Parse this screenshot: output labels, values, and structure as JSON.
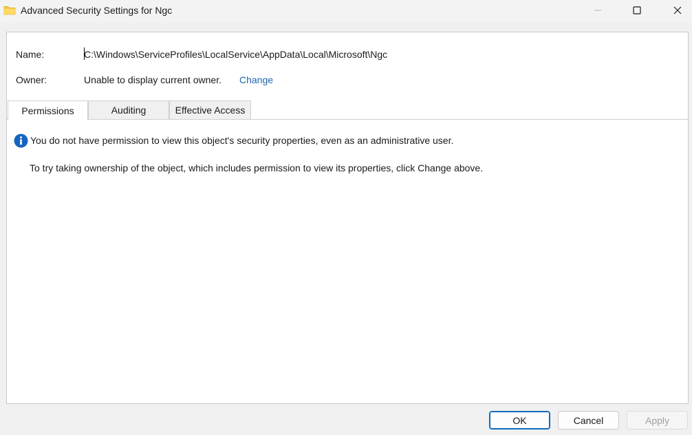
{
  "window": {
    "title": "Advanced Security Settings for Ngc"
  },
  "fields": {
    "name_label": "Name:",
    "name_value": "C:\\Windows\\ServiceProfiles\\LocalService\\AppData\\Local\\Microsoft\\Ngc",
    "owner_label": "Owner:",
    "owner_value": "Unable to display current owner.",
    "change_link": "Change"
  },
  "tabs": [
    {
      "label": "Permissions",
      "selected": true
    },
    {
      "label": "Auditing",
      "selected": false
    },
    {
      "label": "Effective Access",
      "selected": false
    }
  ],
  "messages": {
    "no_permission": "You do not have permission to view this object's security properties, even as an administrative user.",
    "take_ownership": "To try taking ownership of the object, which includes permission to view its properties, click Change above."
  },
  "buttons": {
    "ok": "OK",
    "cancel": "Cancel",
    "apply": "Apply"
  },
  "icons": {
    "title": "folder-icon",
    "info": "info-icon"
  },
  "colors": {
    "link": "#1d66b0",
    "info_blue": "#1565c0",
    "folder_yellow": "#f5c542",
    "default_button_border": "#0f6cbd"
  }
}
